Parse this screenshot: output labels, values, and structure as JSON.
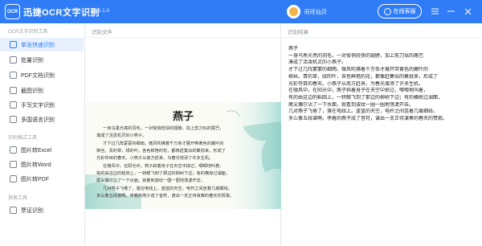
{
  "app": {
    "logo_text": "OCR",
    "title": "迅捷OCR文字识别",
    "version": "v8.6.1.0",
    "user_name": "旺旺仙贝",
    "service_label": "在线客服"
  },
  "sidebar": {
    "sections": [
      {
        "title": "OCR文字识别工具",
        "items": [
          {
            "label": "单张快速识别",
            "icon": "single-image-icon",
            "active": true
          },
          {
            "label": "批量识别",
            "icon": "batch-icon"
          },
          {
            "label": "PDF文档识别",
            "icon": "pdf-icon"
          },
          {
            "label": "截图识别",
            "icon": "screenshot-icon"
          },
          {
            "label": "手写文字识别",
            "icon": "handwriting-icon"
          },
          {
            "label": "多国语言识别",
            "icon": "language-icon"
          }
        ]
      },
      {
        "title": "识别格式工具",
        "items": [
          {
            "label": "图片转Excel",
            "icon": "excel-icon"
          },
          {
            "label": "图片转Word",
            "icon": "word-icon"
          },
          {
            "label": "图片转PDF",
            "icon": "pdf-convert-icon"
          }
        ]
      },
      {
        "title": "其他工具",
        "items": [
          {
            "label": "票证识别",
            "icon": "ticket-icon"
          }
        ]
      }
    ]
  },
  "left_panel": {
    "header": "识别文件",
    "image": {
      "title": "燕子",
      "lines": [
        "一身乌黑光亮的羽毛，一对俊俏轻快的翅膀，加上剪刀似的尾巴，",
        "凑成了活泼机灵的小燕子。",
        "才下过几阵蒙蒙的细雨，微风吹拂着千万条才展开带黄色的嫩叶的",
        "柳丝。青的草，绿的叶，各色鲜艳的花，都像赶集似的聚拢来，形成了",
        "光彩夺目的春天。小燕子从南方赶来，为春光增添了许多生机。",
        "在微风中，在阳光中，燕子斜着身子在天空中掠过，唧唧地叫着，",
        "有的由这边的稻田上，一转眼飞到了那边的柳树下边；有的横掠过湖面，",
        "尾尖偶尔沾了一下水面，就看到波纹一圈一圈地荡漾开去。",
        "几对燕子飞倦了，落在电线上。蓝蓝的天空，电杆之间连着几痕细线，",
        "多么像五线谱啊。停着的燕子成了音符，谱出一支正待演奏的春天的赞歌。"
      ]
    }
  },
  "right_panel": {
    "header": "识别结果",
    "lines": [
      "燕子",
      "一身乌黑光亮的羽毛，一对俊俏轻快的翅膀，加上剪刀似的尾巴",
      "凑成了活泼机灵的小燕子。",
      "才下过几阵蒙蒙的细雨。微风吹拂着千万条才展开带黄色的嫩叶的",
      "柳丝。青的草，绿的叶，各色鲜艳的花，都像赶集似的聚拢来，形成了",
      "光彩夺目的春天。小燕子从南方赶来，为春光增添了许多生机。",
      "在微风中，在阳光中，燕子斜着身子在天空中掠过，唧唧地叫着，",
      "有的由这边的稻田上，一转眼飞到了那边的柳树下边；有的横掠过湖面，",
      "尾尖偶尔沾了一下水面，就看到波纹一圈一圈地荡漾开去。",
      "几对燕子飞倦了，落在电线上。蓝蓝的天空，电杆之间连着几痕细线，",
      "多么像五线谱啊。停着的燕子成了音符，谱出一支正待演奏的春天的赞歌。"
    ]
  },
  "colors": {
    "brand": "#2f7cf6",
    "active_bg": "#e8f0fe"
  }
}
